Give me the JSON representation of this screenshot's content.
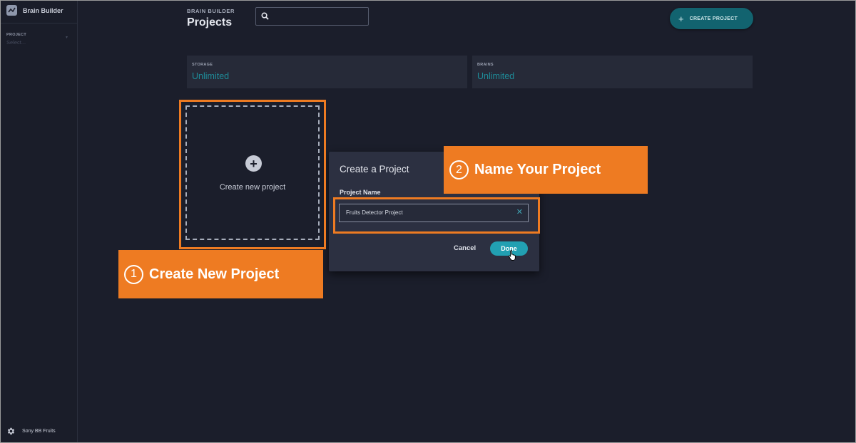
{
  "app": {
    "name": "Brain Builder"
  },
  "sidebar": {
    "project_label": "PROJECT",
    "project_select_placeholder": "Select...",
    "footer_user": "Sony BB Fruits"
  },
  "header": {
    "section": "BRAIN BUILDER",
    "title": "Projects",
    "search_value": "",
    "create_button_label": "CREATE PROJECT"
  },
  "stats": [
    {
      "label": "STORAGE",
      "value": "Unlimited"
    },
    {
      "label": "BRAINS",
      "value": "Unlimited"
    }
  ],
  "new_project_card": {
    "label": "Create new project"
  },
  "dialog": {
    "title": "Create a Project",
    "field_label": "Project Name",
    "field_value": "Fruits Detector Project",
    "cancel_label": "Cancel",
    "done_label": "Done"
  },
  "annotations": [
    {
      "number": "1",
      "text": "Create New Project"
    },
    {
      "number": "2",
      "text": "Name Your Project"
    }
  ],
  "colors": {
    "background": "#1b1e2b",
    "accent": "#22a0b2",
    "annotation": "#ee7b22"
  }
}
